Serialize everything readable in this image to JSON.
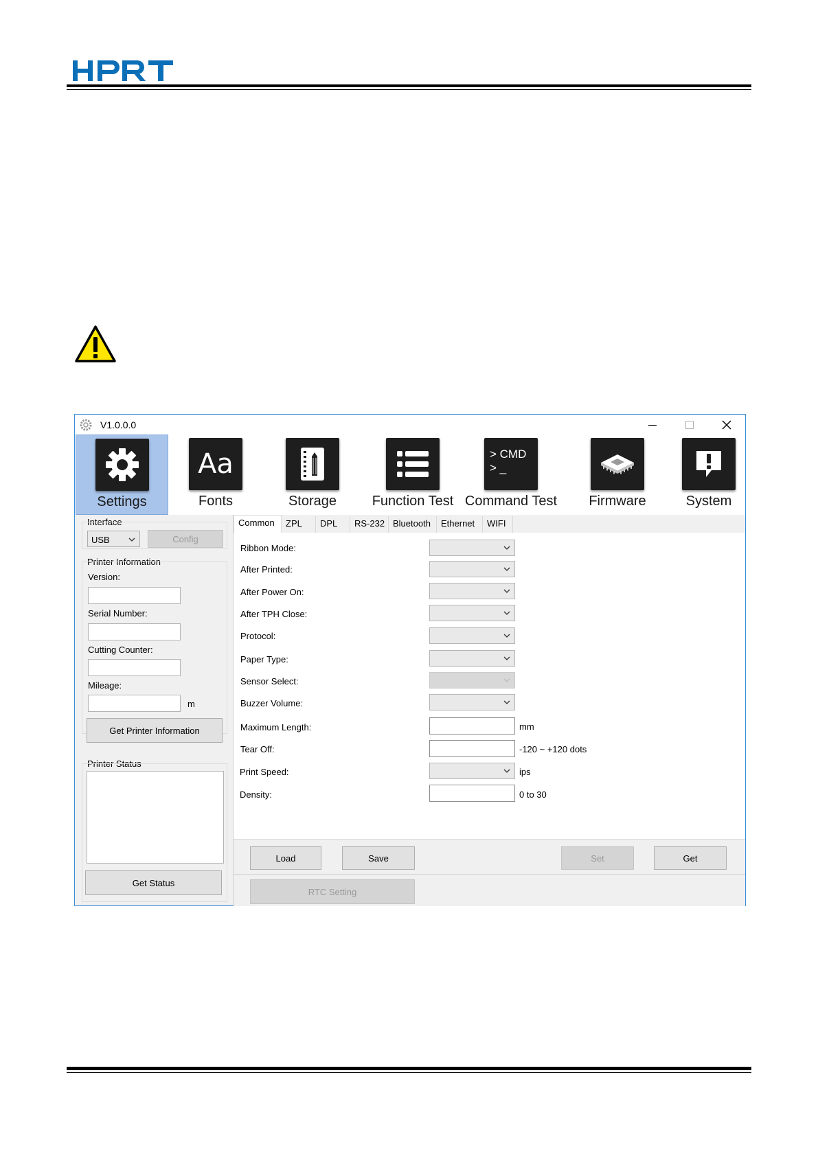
{
  "header": {
    "logo_text": "HPRT",
    "brand_color": "#0b6fb8"
  },
  "warning_icon": "warning-triangle-icon",
  "window": {
    "title": "V1.0.0.0",
    "controls": [
      "minimize-icon",
      "maximize-icon",
      "close-icon"
    ]
  },
  "toolbar": {
    "items": [
      {
        "label": "Settings",
        "icon": "gear-icon"
      },
      {
        "label": "Fonts",
        "icon": "fonts-icon",
        "glyph": "Aa"
      },
      {
        "label": "Storage",
        "icon": "storage-icon"
      },
      {
        "label": "Function Test",
        "icon": "list-icon"
      },
      {
        "label": "Command Test",
        "icon": "cmd-icon",
        "glyph_line1": "> CMD",
        "glyph_line2": "> _"
      },
      {
        "label": "Firmware",
        "icon": "chip-icon"
      },
      {
        "label": "System",
        "icon": "alert-bubble-icon"
      }
    ],
    "active": "Settings",
    "active_color": "#a9c4ea"
  },
  "left": {
    "interface_label": "Interface",
    "interface_value": "USB",
    "config_button": "Config",
    "printer_info_label": "Printer Information",
    "version_label": "Version:",
    "serial_label": "Serial Number:",
    "cutting_label": "Cutting Counter:",
    "mileage_label": "Mileage:",
    "mileage_unit": "m",
    "get_info_button": "Get Printer Information",
    "printer_status_label": "Printer Status",
    "get_status_button": "Get Status"
  },
  "tabs": [
    "Common",
    "ZPL",
    "DPL",
    "RS-232",
    "Bluetooth",
    "Ethernet",
    "WIFI"
  ],
  "active_tab": "Common",
  "form": {
    "ribbon_mode": "Ribbon Mode:",
    "after_printed": "After Printed:",
    "after_power_on": "After Power On:",
    "after_tph_close": "After TPH Close:",
    "protocol": "Protocol:",
    "paper_type": "Paper Type:",
    "sensor_select": "Sensor Select:",
    "buzzer_volume": "Buzzer Volume:",
    "maximum_length": "Maximum Length:",
    "maximum_length_unit": "mm",
    "tear_off": "Tear Off:",
    "tear_off_unit": "-120 ~ +120 dots",
    "print_speed": "Print Speed:",
    "print_speed_unit": "ips",
    "density": "Density:",
    "density_unit": "0 to 30"
  },
  "buttons": {
    "load": "Load",
    "save": "Save",
    "set": "Set",
    "get": "Get",
    "rtc_setting": "RTC Setting"
  }
}
